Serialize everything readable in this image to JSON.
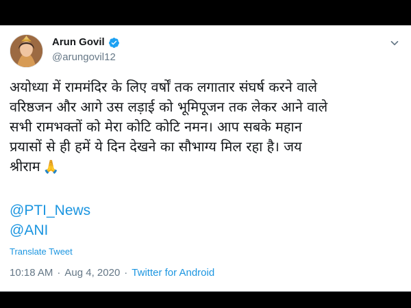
{
  "tweet": {
    "author": {
      "name": "Arun Govil",
      "handle": "@arungovil12"
    },
    "text": "अयोध्या में राममंदिर के लिए वर्षों तक लगातार संघर्ष करने वाले\nवरिष्ठजन और आगे उस लड़ाई को भूमिपूजन तक लेकर आने वाले\nसभी रामभक्तों को मेरा कोटि कोटि नमन। आप सबके महान\nप्रयासों से ही हमें ये दिन देखने का सौभाग्य मिल रहा है। जय\nश्रीराम",
    "emoji": "🙏",
    "mentions": [
      "@PTI_News",
      "@ANI"
    ],
    "translate_label": "Translate Tweet",
    "time": "10:18 AM",
    "separator": "·",
    "date": "Aug 4, 2020",
    "source": "Twitter for Android"
  },
  "colors": {
    "link": "#1b95e0",
    "text": "#14171a",
    "secondary": "#657786",
    "verified": "#1da1f2"
  },
  "icons": {
    "verified": "verified-badge-icon",
    "more": "chevron-down-icon",
    "emoji": "folded-hands-icon"
  }
}
